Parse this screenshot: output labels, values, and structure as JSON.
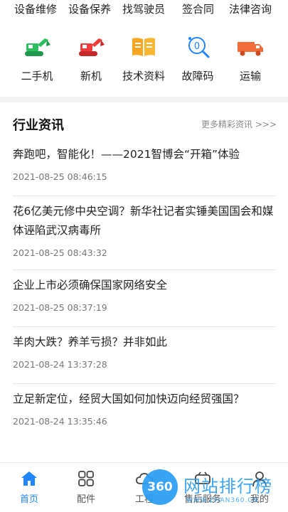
{
  "top_services": [
    "设备维修",
    "设备保养",
    "找驾驶员",
    "签合同",
    "法律咨询"
  ],
  "categories": [
    {
      "label": "二手机",
      "icon": "excavator-icon",
      "color": "#2dbe60"
    },
    {
      "label": "新机",
      "icon": "excavator-icon",
      "color": "#ef3b3b"
    },
    {
      "label": "技术资料",
      "icon": "book-icon",
      "color": "#f5a623"
    },
    {
      "label": "故障码",
      "icon": "error-code-icon",
      "color": "#1f86ff"
    },
    {
      "label": "运输",
      "icon": "truck-icon",
      "color": "#f26b3a"
    }
  ],
  "news": {
    "title": "行业资讯",
    "more": "更多精彩资讯 >>>",
    "items": [
      {
        "title": "奔跑吧，智能化！——2021智博会“开箱”体验",
        "date": "2021-08-25 08:46:15"
      },
      {
        "title": "花6亿美元修中央空调？新华社记者实锤美国国会和媒体诬陷武汉病毒所",
        "date": "2021-08-25 08:43:32"
      },
      {
        "title": "企业上市必须确保国家网络安全",
        "date": "2021-08-25 08:37:19"
      },
      {
        "title": "羊肉大跌？养羊亏损？并非如此",
        "date": "2021-08-24 13:37:28"
      },
      {
        "title": "立足新定位，经贸大国如何加快迈向经贸强国？",
        "date": "2021-08-24 13:35:46"
      }
    ]
  },
  "tabs": [
    {
      "label": "首页",
      "icon": "home-icon",
      "active": true
    },
    {
      "label": "配件",
      "icon": "grid-icon",
      "active": false
    },
    {
      "label": "工程",
      "icon": "cloud-icon",
      "active": false
    },
    {
      "label": "售后服务",
      "icon": "service-icon",
      "active": false
    },
    {
      "label": "我的",
      "icon": "user-icon",
      "active": false
    }
  ],
  "watermark": {
    "badge": "360",
    "text": "网站排行榜",
    "sub": "WWW.ZHAN360.CN"
  },
  "colors": {
    "accent": "#1f86ff",
    "watermark": "#2a9df4"
  }
}
